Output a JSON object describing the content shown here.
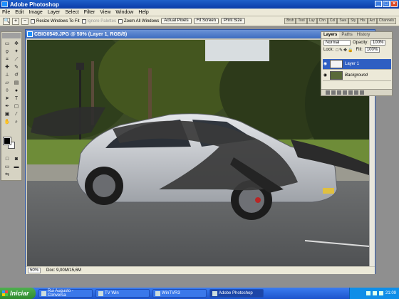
{
  "app": {
    "title": "Adobe Photoshop"
  },
  "menu": [
    "File",
    "Edit",
    "Image",
    "Layer",
    "Select",
    "Filter",
    "View",
    "Window",
    "Help"
  ],
  "options": {
    "resize_windows": "Resize Windows To Fit",
    "ignore_palettes": "Ignore Palettes",
    "zoom_all": "Zoom All Windows",
    "actual_pixels": "Actual Pixels",
    "fit_screen": "Fit Screen",
    "print_size": "Print Size",
    "wells": [
      "Brsh",
      "Tool",
      "Lay",
      "Chn",
      "Col",
      "Swa",
      "Sty",
      "His",
      "Act",
      "Channels"
    ]
  },
  "document": {
    "title": "CBIG0549.JPG @ 50% (Layer 1, RGB/8)",
    "zoom": "50%",
    "doc_size": "Doc: 9,00M/15,6M"
  },
  "layers_panel": {
    "tabs": [
      "Layers",
      "Paths",
      "History"
    ],
    "blend_mode": "Normal",
    "opacity_label": "Opacity:",
    "opacity_value": "100%",
    "lock_label": "Lock:",
    "fill_label": "Fill:",
    "fill_value": "100%",
    "layers": [
      {
        "name": "Layer 1",
        "active": true
      },
      {
        "name": "Background",
        "active": false
      }
    ]
  },
  "taskbar": {
    "start": "Iniciar",
    "items": [
      {
        "label": "Rui Augusto - Conversa"
      },
      {
        "label": "TV Win"
      },
      {
        "label": "WinTVR3"
      },
      {
        "label": "Adobe Photoshop",
        "active": true
      }
    ],
    "clock": "21:09"
  },
  "colors": {
    "title_blue": "#0a3ca8",
    "taskbar_blue": "#245edb",
    "start_green": "#3c9a3c",
    "layer_selected": "#2f5fc2"
  }
}
